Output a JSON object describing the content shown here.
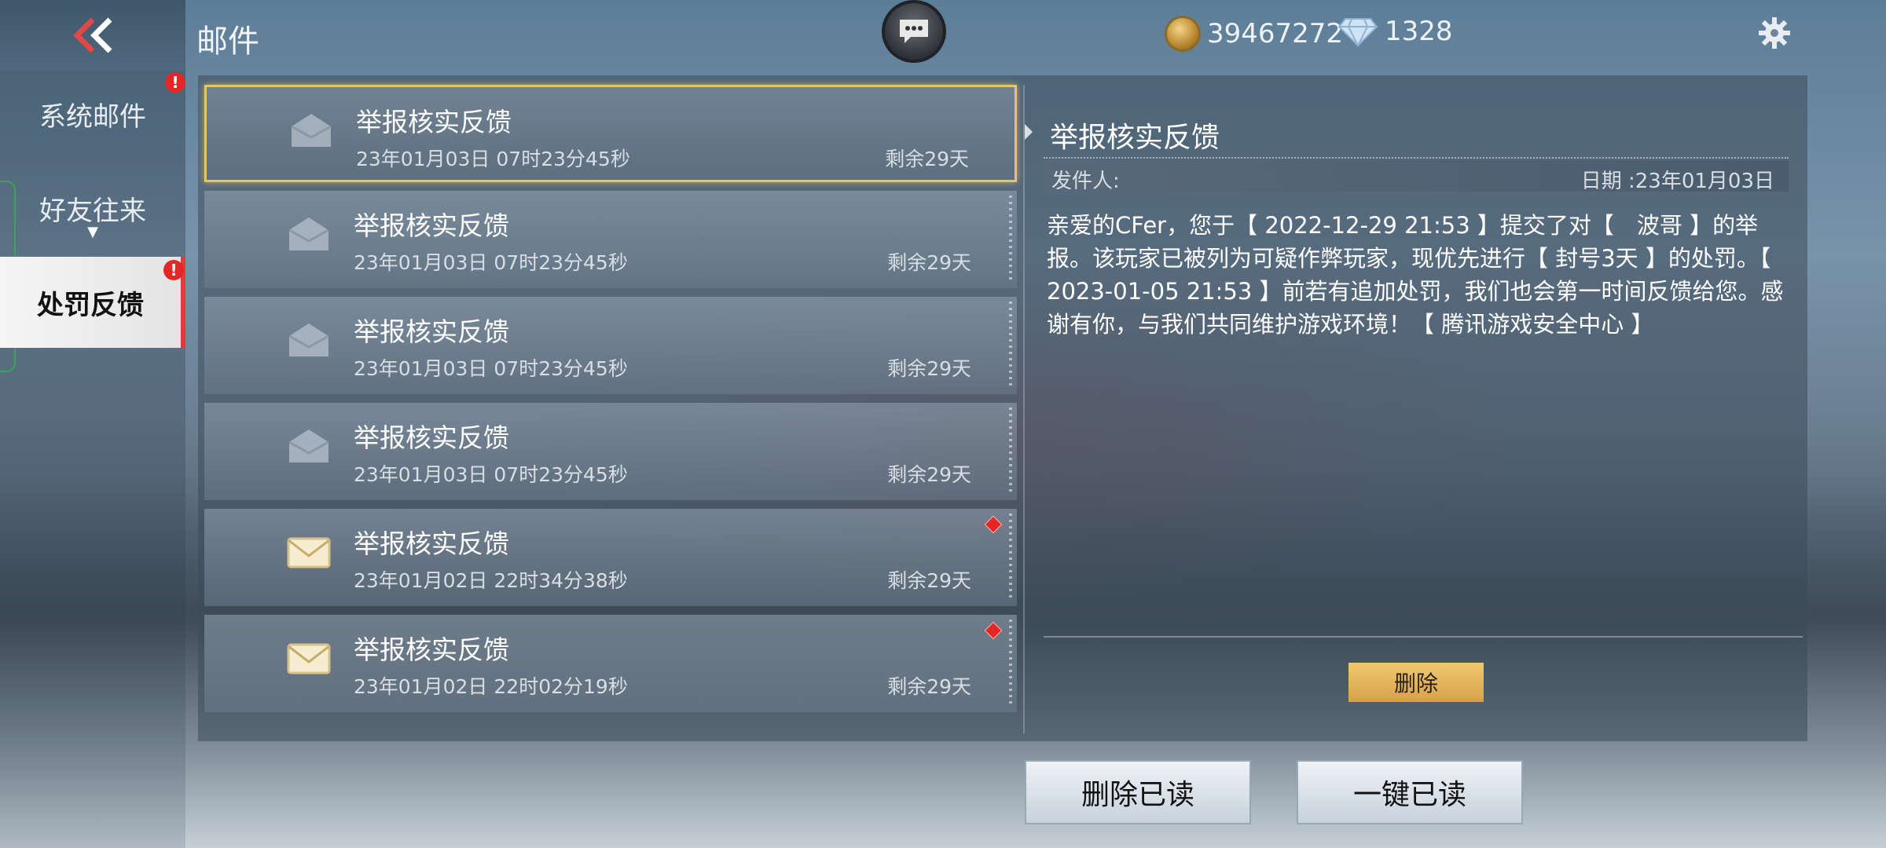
{
  "header": {
    "title": "邮件",
    "gold_amount": "39467272",
    "diamond_amount": "1328"
  },
  "tabs": [
    {
      "label": "系统邮件",
      "alert": "!"
    },
    {
      "label": "好友往来",
      "arrow": "▼"
    },
    {
      "label": "处罚反馈",
      "alert": "!"
    }
  ],
  "mails": [
    {
      "title": "举报核实反馈",
      "date": "23年01月03日 07时23分45秒",
      "remaining": "剩余29天",
      "read": true
    },
    {
      "title": "举报核实反馈",
      "date": "23年01月03日 07时23分45秒",
      "remaining": "剩余29天",
      "read": true
    },
    {
      "title": "举报核实反馈",
      "date": "23年01月03日 07时23分45秒",
      "remaining": "剩余29天",
      "read": true
    },
    {
      "title": "举报核实反馈",
      "date": "23年01月03日 07时23分45秒",
      "remaining": "剩余29天",
      "read": true
    },
    {
      "title": "举报核实反馈",
      "date": "23年01月02日 22时34分38秒",
      "remaining": "剩余29天",
      "read": false
    },
    {
      "title": "举报核实反馈",
      "date": "23年01月02日 22时02分19秒",
      "remaining": "剩余29天",
      "read": false
    }
  ],
  "detail": {
    "title": "举报核实反馈",
    "sender_label": "发件人:",
    "date_label": "日期 :23年01月03日",
    "body": "亲爱的CFer，您于【 2022-12-29 21:53 】提交了对【　波哥 】的举报。该玩家已被列为可疑作弊玩家，现优先进行【 封号3天 】的处罚。【 2023-01-05 21:53 】前若有追加处罚，我们也会第一时间反馈给您。感谢有你，与我们共同维护游戏环境！【 腾讯游戏安全中心 】",
    "delete_label": "删除"
  },
  "actions": {
    "delete_read_label": "删除已读",
    "read_all_label": "一键已读"
  },
  "colors": {
    "accent_gold": "#e9c36c",
    "alert_red": "#e32626"
  }
}
